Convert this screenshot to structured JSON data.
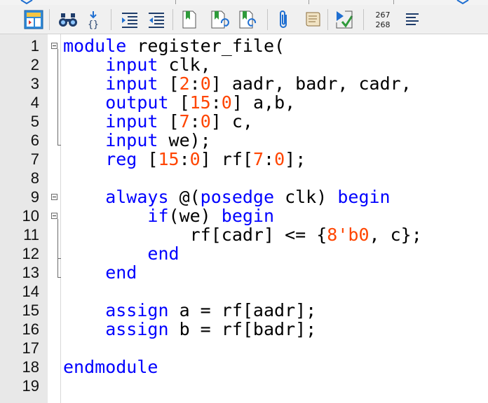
{
  "toolbar": {
    "icons": [
      "layout-icon",
      "binoculars-icon",
      "bracket-jump-icon",
      "indent-icon",
      "outdent-icon",
      "bookmark-icon",
      "bookmark-next-icon",
      "bookmark-prev-icon",
      "paperclip-icon",
      "scroll-icon",
      "run-check-icon",
      "line-indicator",
      "align-icon"
    ],
    "line_from": "267",
    "line_to": "268"
  },
  "editor": {
    "line_numbers": [
      "1",
      "2",
      "3",
      "4",
      "5",
      "6",
      "7",
      "8",
      "9",
      "10",
      "11",
      "12",
      "13",
      "14",
      "15",
      "16",
      "17",
      "18",
      "19"
    ],
    "lines": [
      [
        {
          "t": "module register_file(",
          "c": "kwmix",
          "parts": [
            {
              "t": "module",
              "k": "kw"
            },
            {
              "t": " register_file(",
              "k": "txt"
            }
          ]
        }
      ],
      [
        {
          "parts": [
            {
              "t": "    input",
              "k": "kw"
            },
            {
              "t": " clk,",
              "k": "txt"
            }
          ]
        }
      ],
      [
        {
          "parts": [
            {
              "t": "    input",
              "k": "kw"
            },
            {
              "t": " [",
              "k": "txt"
            },
            {
              "t": "2",
              "k": "num"
            },
            {
              "t": ":",
              "k": "txt"
            },
            {
              "t": "0",
              "k": "num"
            },
            {
              "t": "] aadr, badr, cadr,",
              "k": "txt"
            }
          ]
        }
      ],
      [
        {
          "parts": [
            {
              "t": "    output",
              "k": "kw"
            },
            {
              "t": " [",
              "k": "txt"
            },
            {
              "t": "15",
              "k": "num"
            },
            {
              "t": ":",
              "k": "txt"
            },
            {
              "t": "0",
              "k": "num"
            },
            {
              "t": "] a,b,",
              "k": "txt"
            }
          ]
        }
      ],
      [
        {
          "parts": [
            {
              "t": "    input",
              "k": "kw"
            },
            {
              "t": " [",
              "k": "txt"
            },
            {
              "t": "7",
              "k": "num"
            },
            {
              "t": ":",
              "k": "txt"
            },
            {
              "t": "0",
              "k": "num"
            },
            {
              "t": "] c,",
              "k": "txt"
            }
          ]
        }
      ],
      [
        {
          "parts": [
            {
              "t": "    input",
              "k": "kw"
            },
            {
              "t": " we);",
              "k": "txt"
            }
          ]
        }
      ],
      [
        {
          "parts": [
            {
              "t": "    reg",
              "k": "kw"
            },
            {
              "t": " [",
              "k": "txt"
            },
            {
              "t": "15",
              "k": "num"
            },
            {
              "t": ":",
              "k": "txt"
            },
            {
              "t": "0",
              "k": "num"
            },
            {
              "t": "] rf[",
              "k": "txt"
            },
            {
              "t": "7",
              "k": "num"
            },
            {
              "t": ":",
              "k": "txt"
            },
            {
              "t": "0",
              "k": "num"
            },
            {
              "t": "];",
              "k": "txt"
            }
          ]
        }
      ],
      [
        {
          "parts": []
        }
      ],
      [
        {
          "parts": [
            {
              "t": "    always",
              "k": "kw"
            },
            {
              "t": " @(",
              "k": "txt"
            },
            {
              "t": "posedge",
              "k": "kw"
            },
            {
              "t": " clk) ",
              "k": "txt"
            },
            {
              "t": "begin",
              "k": "kw"
            }
          ]
        }
      ],
      [
        {
          "parts": [
            {
              "t": "        if",
              "k": "kw"
            },
            {
              "t": "(we) ",
              "k": "txt"
            },
            {
              "t": "begin",
              "k": "kw"
            }
          ]
        }
      ],
      [
        {
          "parts": [
            {
              "t": "            rf[cadr] <= {",
              "k": "txt"
            },
            {
              "t": "8'b0",
              "k": "num"
            },
            {
              "t": ", c};",
              "k": "txt"
            }
          ]
        }
      ],
      [
        {
          "parts": [
            {
              "t": "        end",
              "k": "kw"
            }
          ]
        }
      ],
      [
        {
          "parts": [
            {
              "t": "    end",
              "k": "kw"
            }
          ]
        }
      ],
      [
        {
          "parts": []
        }
      ],
      [
        {
          "parts": [
            {
              "t": "    assign",
              "k": "kw"
            },
            {
              "t": " a = rf[aadr];",
              "k": "txt"
            }
          ]
        }
      ],
      [
        {
          "parts": [
            {
              "t": "    assign",
              "k": "kw"
            },
            {
              "t": " b = rf[badr];",
              "k": "txt"
            }
          ]
        }
      ],
      [
        {
          "parts": []
        }
      ],
      [
        {
          "parts": [
            {
              "t": "endmodule",
              "k": "kw"
            }
          ]
        }
      ],
      [
        {
          "parts": []
        }
      ]
    ]
  },
  "colors": {
    "keyword": "#0000ff",
    "number": "#ff4500",
    "text": "#000000",
    "gutter": "#e8e8e8"
  }
}
